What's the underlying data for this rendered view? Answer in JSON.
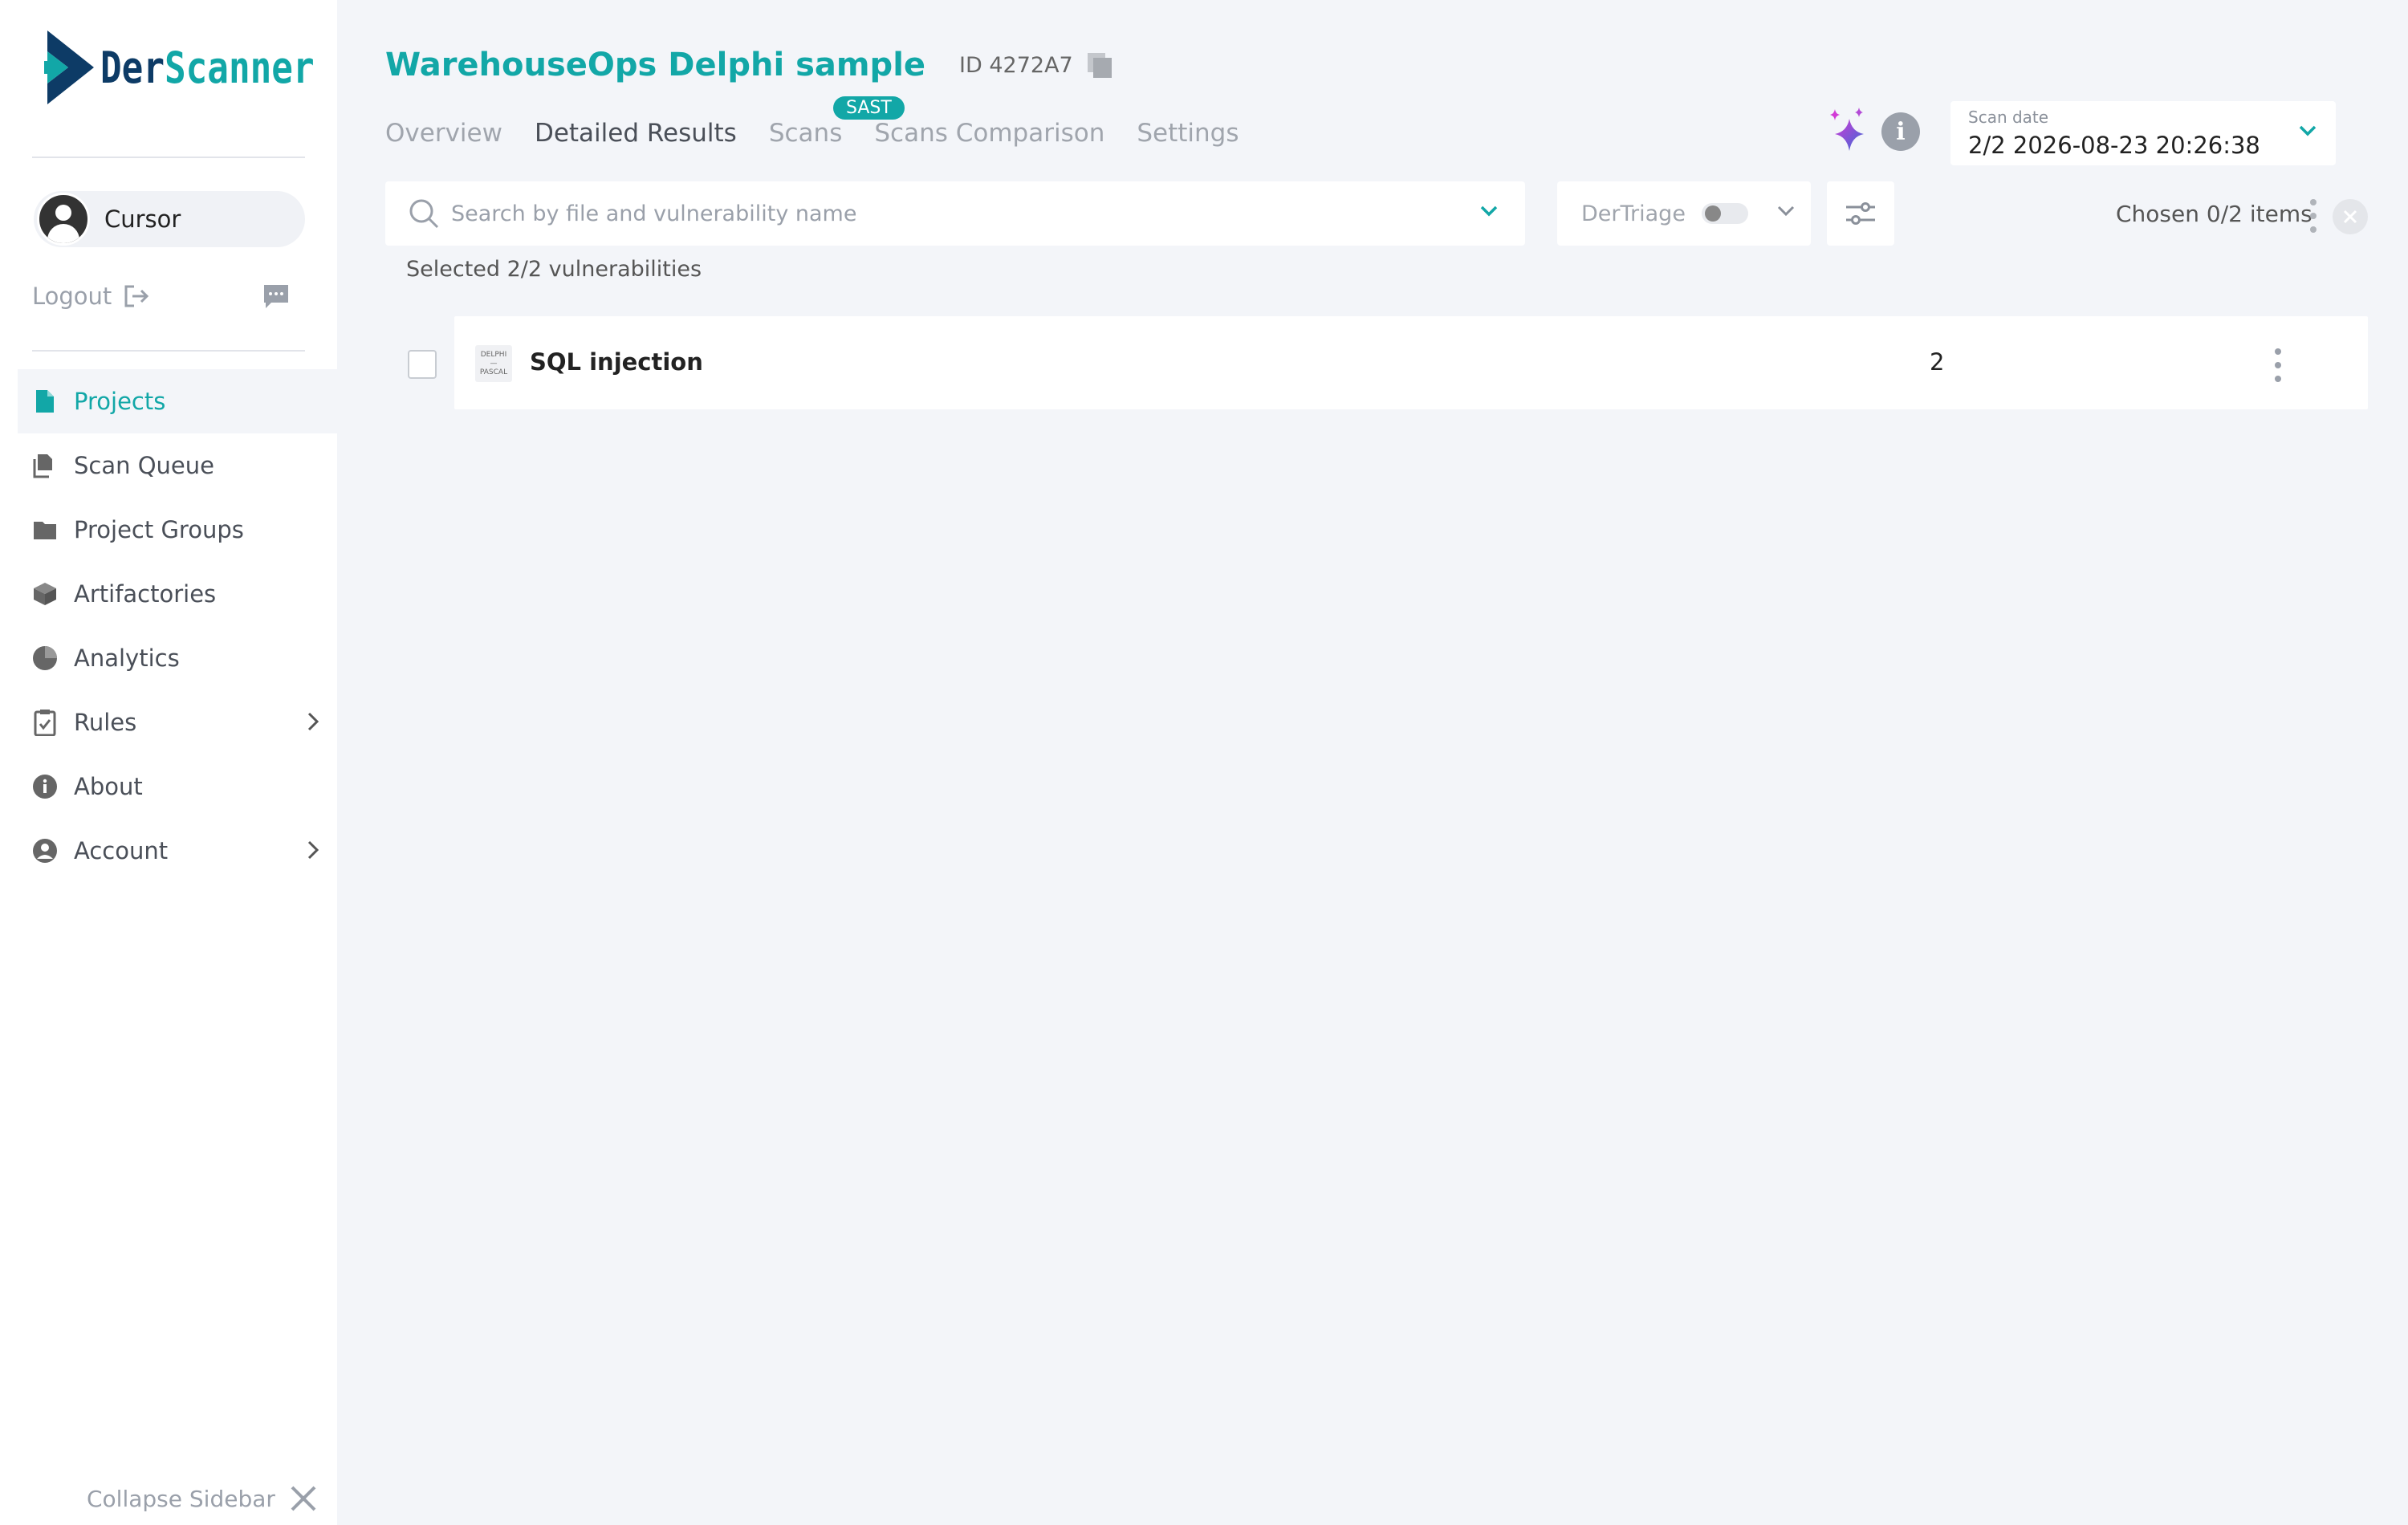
{
  "brand": {
    "name_part1": "Der",
    "name_part2": "Scanner"
  },
  "user": {
    "name": "Cursor"
  },
  "sidebar": {
    "logout_label": "Logout",
    "items": [
      {
        "label": "Projects",
        "icon": "file-icon",
        "active": true
      },
      {
        "label": "Scan Queue",
        "icon": "scan-queue-icon"
      },
      {
        "label": "Project Groups",
        "icon": "folder-icon"
      },
      {
        "label": "Artifactories",
        "icon": "cube-icon"
      },
      {
        "label": "Analytics",
        "icon": "pie-chart-icon"
      },
      {
        "label": "Rules",
        "icon": "clipboard-check-icon",
        "expandable": true
      },
      {
        "label": "About",
        "icon": "info-icon"
      },
      {
        "label": "Account",
        "icon": "user-circle-icon",
        "expandable": true
      }
    ],
    "collapse_label": "Collapse Sidebar"
  },
  "project": {
    "title": "WarehouseOps Delphi sample",
    "id_text": "ID 4272A7"
  },
  "tabs": [
    {
      "label": "Overview"
    },
    {
      "label": "Detailed Results",
      "active": true,
      "badge": "SAST"
    },
    {
      "label": "Scans"
    },
    {
      "label": "Scans Comparison"
    },
    {
      "label": "Settings"
    }
  ],
  "scan_date": {
    "label": "Scan date",
    "value": "2/2 2026-08-23 20:26:38"
  },
  "search": {
    "placeholder": "Search by file and vulnerability name",
    "value": ""
  },
  "triage": {
    "label": "DerTriage",
    "enabled": false
  },
  "chosen_text": "Chosen 0/2 items",
  "selected_text": "Selected 2/2 vulnerabilities",
  "vulnerabilities": [
    {
      "language_badge_top": "DELPHI",
      "language_badge_bottom": "PASCAL",
      "name": "SQL injection",
      "count": "2"
    }
  ],
  "colors": {
    "accent": "#12a7a7",
    "brand_dark": "#0d3b66",
    "background": "#f3f5f9"
  }
}
